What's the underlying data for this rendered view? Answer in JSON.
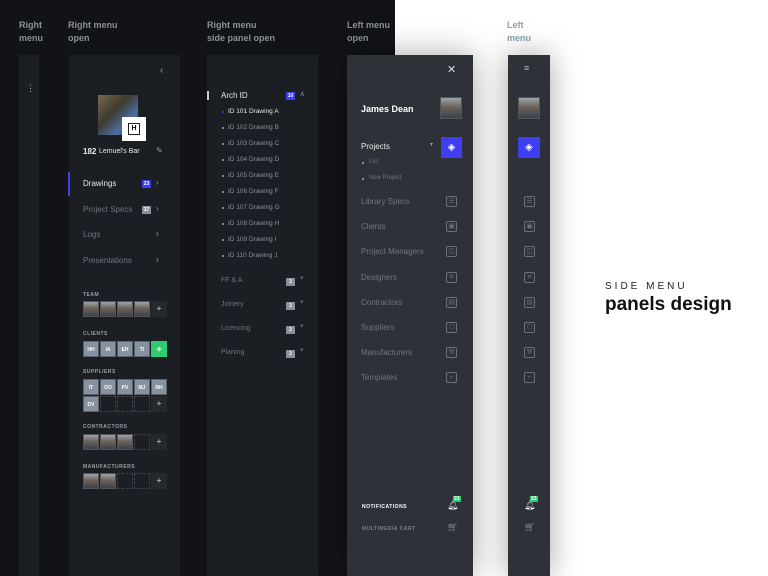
{
  "headings": {
    "col1": "Right\nmenu",
    "col2": "Right menu\nopen",
    "col3": "Right menu\nside panel open",
    "col4": "Left menu\nopen",
    "col5": "Left\nmenu"
  },
  "right_menu_open": {
    "project_number": "182",
    "project_name": "Lemuel's Bar",
    "logo_letter": "H",
    "nav": [
      {
        "label": "Drawings",
        "badge": "23"
      },
      {
        "label": "Project Specs",
        "badge": "37"
      },
      {
        "label": "Logs"
      },
      {
        "label": "Presentations"
      }
    ],
    "sections": {
      "team": {
        "label": "TEAM"
      },
      "clients": {
        "label": "CLIENTS",
        "items": [
          "HH",
          "IA",
          "EH",
          "TI"
        ]
      },
      "suppliers": {
        "label": "SUPPLIERS",
        "items": [
          "IT",
          "DO",
          "PV",
          "MJ",
          "RH",
          "DV"
        ]
      },
      "contractors": {
        "label": "CONTRACTORS"
      },
      "manufacturers": {
        "label": "MANUFACTURERS"
      }
    },
    "add": "+"
  },
  "side_panel": {
    "group": {
      "label": "Arch ID",
      "badge": "10"
    },
    "items": [
      "ID 101 Drawing A",
      "ID 102 Drawing B",
      "ID 103 Drawing C",
      "ID 104 Drawing D",
      "ID 105 Drawing E",
      "ID 106 Drawing F",
      "ID 107 Drawing G",
      "ID 108 Drawing H",
      "ID 109 Drawing I",
      "ID 110 Drawing J"
    ],
    "groups": [
      {
        "label": "FF & A",
        "badge": "3"
      },
      {
        "label": "Joinery",
        "badge": "3"
      },
      {
        "label": "Licencing",
        "badge": "2"
      },
      {
        "label": "Planing",
        "badge": "2"
      }
    ]
  },
  "left_menu": {
    "user": "James Dean",
    "projects": {
      "label": "Projects",
      "sub": [
        "List",
        "New Project"
      ]
    },
    "items": [
      {
        "label": "Library Specs",
        "icon": "list-icon"
      },
      {
        "label": "Clients",
        "icon": "briefcase-icon"
      },
      {
        "label": "Project Managers",
        "icon": "contact-icon"
      },
      {
        "label": "Designers",
        "icon": "tools-icon"
      },
      {
        "label": "Contractors",
        "icon": "document-icon"
      },
      {
        "label": "Suppliers",
        "icon": "box-icon"
      },
      {
        "label": "Manufacturers",
        "icon": "hammer-icon"
      },
      {
        "label": "Templates",
        "icon": "crop-icon"
      }
    ],
    "notifications": {
      "label": "NOTIFICATIONS",
      "count": "23"
    },
    "cart": "MULTIMEDIA CART"
  },
  "promo": {
    "kicker": "SIDE MENU",
    "title": "panels design"
  },
  "colors": {
    "accent": "#3f3ff2",
    "green": "#2ecc71",
    "panel": "#2e3238"
  }
}
